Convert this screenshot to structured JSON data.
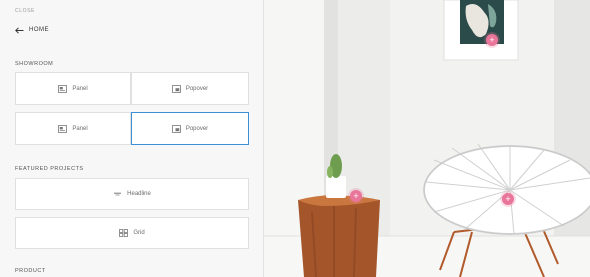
{
  "nav": {
    "close_label": "CLOSE",
    "home_label": "HOME"
  },
  "sections": {
    "showroom": "SHOWROOM",
    "featured_projects": "FEATURED PROJECTS",
    "product": "PRODUCT"
  },
  "showroom_tiles": [
    {
      "label": "Panel",
      "icon": "panel-icon"
    },
    {
      "label": "Popover",
      "icon": "popover-icon"
    },
    {
      "label": "Panel",
      "icon": "panel-icon"
    },
    {
      "label": "Popover",
      "icon": "popover-icon",
      "selected": true
    }
  ],
  "featured_tiles": [
    {
      "label": "Headline",
      "icon": "headline-icon"
    },
    {
      "label": "Grid",
      "icon": "grid-icon"
    }
  ],
  "preview": {
    "hotspot_symbol": "+"
  },
  "colors": {
    "accent_blue": "#3b8fd6",
    "hotspot_pink": "#e9769a"
  }
}
